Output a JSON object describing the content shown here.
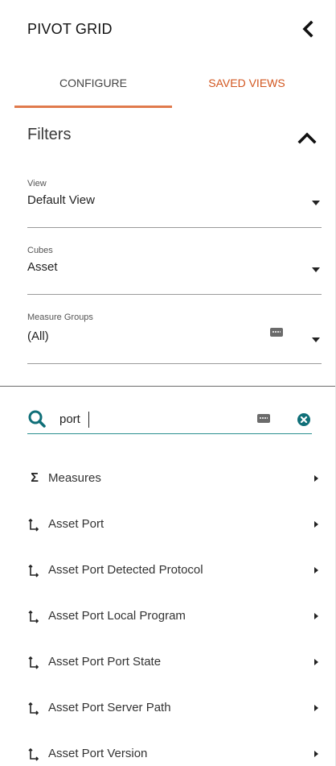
{
  "header": {
    "title": "PIVOT GRID",
    "collapse_icon": "chevron-left-icon"
  },
  "tabs": [
    {
      "label": "CONFIGURE",
      "active": true
    },
    {
      "label": "SAVED VIEWS",
      "active": false
    }
  ],
  "colors": {
    "accent_orange": "#d2561f",
    "tab_underline": "#e07a4c",
    "search_teal": "#0f6f78"
  },
  "filters": {
    "title": "Filters",
    "expanded": true,
    "fields": [
      {
        "label": "View",
        "value": "Default View"
      },
      {
        "label": "Cubes",
        "value": "Asset"
      },
      {
        "label": "Measure Groups",
        "value": "(All)",
        "has_keyboard_icon": true
      }
    ]
  },
  "search": {
    "value": "port",
    "icon": "search-icon",
    "keyboard_icon": "keyboard-icon",
    "clear_icon": "clear-circle-icon"
  },
  "list": {
    "items": [
      {
        "label": "Measures",
        "icon": "sigma-icon"
      },
      {
        "label": "Asset Port",
        "icon": "hierarchy-icon"
      },
      {
        "label": "Asset Port Detected Protocol",
        "icon": "hierarchy-icon"
      },
      {
        "label": "Asset Port Local Program",
        "icon": "hierarchy-icon"
      },
      {
        "label": "Asset Port Port State",
        "icon": "hierarchy-icon"
      },
      {
        "label": "Asset Port Server Path",
        "icon": "hierarchy-icon"
      },
      {
        "label": "Asset Port Version",
        "icon": "hierarchy-icon"
      }
    ]
  }
}
